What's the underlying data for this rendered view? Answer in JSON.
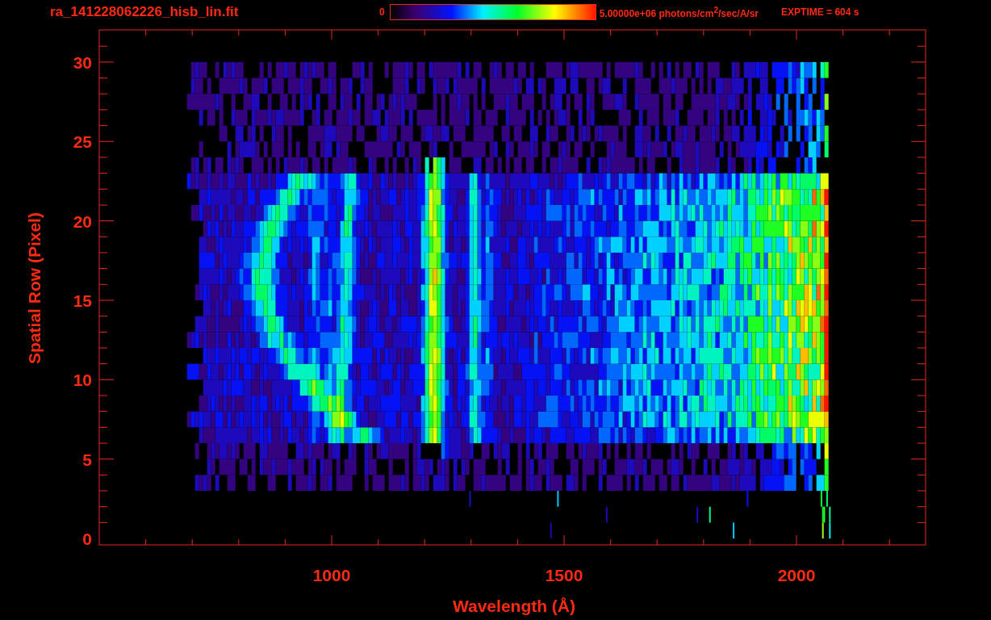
{
  "header": {
    "title": "ra_141228062226_hisb_lin.fit",
    "colorbar": {
      "min_label": "0",
      "max_label": "5.00000e+06 photons/cm$^{2}$/sec/A/sr"
    },
    "exposure": "EXPTIME = 604 s"
  },
  "plot": {
    "xlabel": "Wavelength (Å)",
    "ylabel": "Spatial Row (Pixel)",
    "xtick_labels": [
      "1000",
      "1500",
      "2000"
    ],
    "ytick_labels": [
      "30",
      "25",
      "20",
      "15",
      "10",
      "5",
      "0"
    ]
  }
}
